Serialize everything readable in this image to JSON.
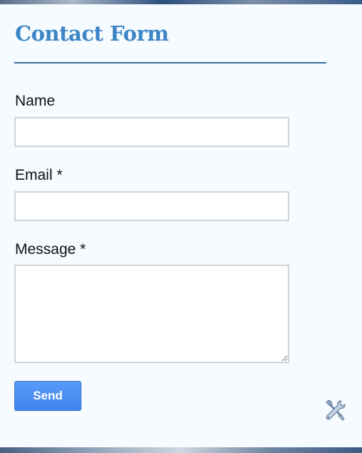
{
  "form": {
    "title": "Contact Form",
    "fields": {
      "name_label": "Name",
      "name_value": "",
      "email_label": "Email *",
      "email_value": "",
      "message_label": "Message *",
      "message_value": ""
    },
    "send_label": "Send"
  },
  "icons": {
    "settings": "wrench-screwdriver-icon"
  },
  "colors": {
    "title": "#3d85c6",
    "rule": "#3b6e9e",
    "button": "#4a8ff5",
    "background": "#f5fbff"
  }
}
